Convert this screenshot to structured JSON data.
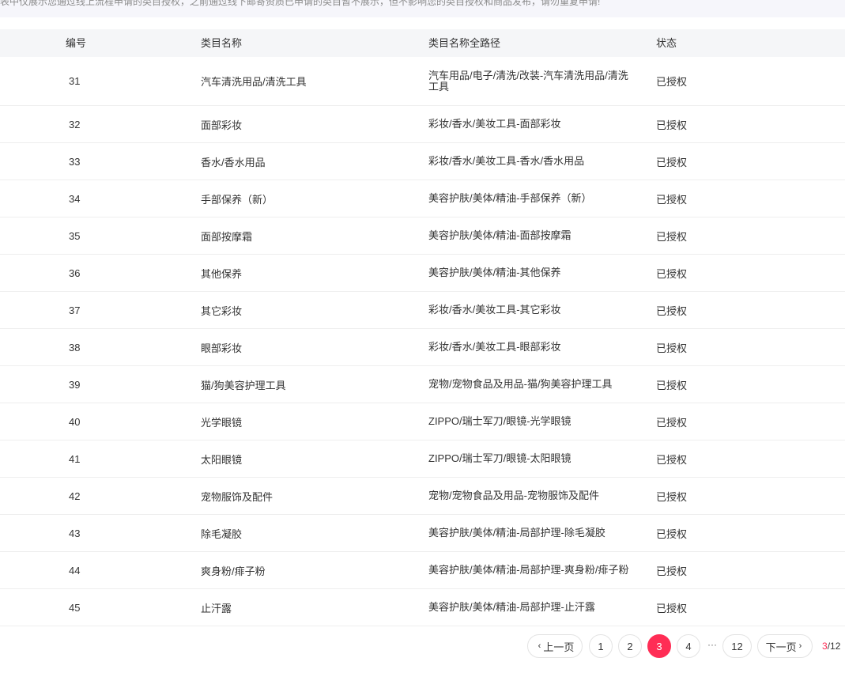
{
  "notice": {
    "text": "表中仅展示您通过线上流程申请的类目授权，之前通过线下邮寄资质已申请的类目暂不展示，但不影响您的类目授权和商品发布，请勿重复申请!"
  },
  "table": {
    "headers": [
      "编号",
      "类目名称",
      "类目名称全路径",
      "状态"
    ],
    "rows": [
      {
        "id": "31",
        "name": "汽车清洗用品/清洗工具",
        "path": "汽车用品/电子/清洗/改装-汽车清洗用品/清洗工具",
        "status": "已授权"
      },
      {
        "id": "32",
        "name": "面部彩妆",
        "path": "彩妆/香水/美妆工具-面部彩妆",
        "status": "已授权"
      },
      {
        "id": "33",
        "name": "香水/香水用品",
        "path": "彩妆/香水/美妆工具-香水/香水用品",
        "status": "已授权"
      },
      {
        "id": "34",
        "name": "手部保养（新）",
        "path": "美容护肤/美体/精油-手部保养（新）",
        "status": "已授权"
      },
      {
        "id": "35",
        "name": "面部按摩霜",
        "path": "美容护肤/美体/精油-面部按摩霜",
        "status": "已授权"
      },
      {
        "id": "36",
        "name": "其他保养",
        "path": "美容护肤/美体/精油-其他保养",
        "status": "已授权"
      },
      {
        "id": "37",
        "name": "其它彩妆",
        "path": "彩妆/香水/美妆工具-其它彩妆",
        "status": "已授权"
      },
      {
        "id": "38",
        "name": "眼部彩妆",
        "path": "彩妆/香水/美妆工具-眼部彩妆",
        "status": "已授权"
      },
      {
        "id": "39",
        "name": "猫/狗美容护理工具",
        "path": "宠物/宠物食品及用品-猫/狗美容护理工具",
        "status": "已授权"
      },
      {
        "id": "40",
        "name": "光学眼镜",
        "path": "ZIPPO/瑞士军刀/眼镜-光学眼镜",
        "status": "已授权"
      },
      {
        "id": "41",
        "name": "太阳眼镜",
        "path": "ZIPPO/瑞士军刀/眼镜-太阳眼镜",
        "status": "已授权"
      },
      {
        "id": "42",
        "name": "宠物服饰及配件",
        "path": "宠物/宠物食品及用品-宠物服饰及配件",
        "status": "已授权"
      },
      {
        "id": "43",
        "name": "除毛凝胶",
        "path": "美容护肤/美体/精油-局部护理-除毛凝胶",
        "status": "已授权"
      },
      {
        "id": "44",
        "name": "爽身粉/痱子粉",
        "path": "美容护肤/美体/精油-局部护理-爽身粉/痱子粉",
        "status": "已授权"
      },
      {
        "id": "45",
        "name": "止汗露",
        "path": "美容护肤/美体/精油-局部护理-止汗露",
        "status": "已授权"
      }
    ]
  },
  "pagination": {
    "prev_label": "上一页",
    "next_label": "下一页",
    "pages": [
      "1",
      "2",
      "3",
      "4",
      "12"
    ],
    "ellipsis": "···",
    "current": "3",
    "total_sep": "/12",
    "accent": "#ff2d55"
  }
}
